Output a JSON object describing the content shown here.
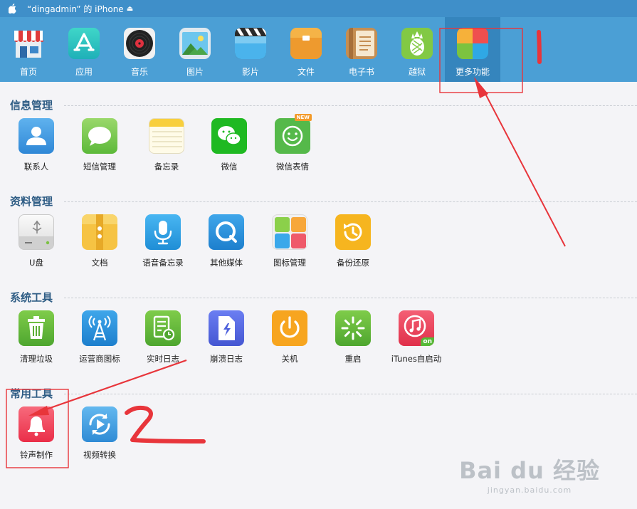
{
  "titlebar": {
    "device_name": "“dingadmin” 的 iPhone"
  },
  "toolbar": {
    "items": [
      {
        "label": "首页"
      },
      {
        "label": "应用"
      },
      {
        "label": "音乐"
      },
      {
        "label": "图片"
      },
      {
        "label": "影片"
      },
      {
        "label": "文件"
      },
      {
        "label": "电子书"
      },
      {
        "label": "越狱"
      },
      {
        "label": "更多功能"
      }
    ]
  },
  "sections": [
    {
      "title": "信息管理",
      "apps": [
        {
          "label": "联系人"
        },
        {
          "label": "短信管理"
        },
        {
          "label": "备忘录"
        },
        {
          "label": "微信"
        },
        {
          "label": "微信表情",
          "badge": "NEW"
        }
      ]
    },
    {
      "title": "资料管理",
      "apps": [
        {
          "label": "U盘"
        },
        {
          "label": "文档"
        },
        {
          "label": "语音备忘录"
        },
        {
          "label": "其他媒体"
        },
        {
          "label": "图标管理"
        },
        {
          "label": "备份还原"
        }
      ]
    },
    {
      "title": "系统工具",
      "apps": [
        {
          "label": "清理垃圾"
        },
        {
          "label": "运营商图标"
        },
        {
          "label": "实时日志"
        },
        {
          "label": "崩溃日志"
        },
        {
          "label": "关机"
        },
        {
          "label": "重启"
        },
        {
          "label": "iTunes自启动",
          "badge": "on"
        }
      ]
    },
    {
      "title": "常用工具",
      "apps": [
        {
          "label": "铃声制作"
        },
        {
          "label": "视频转换"
        }
      ]
    }
  ],
  "annotations": {
    "mark1": "1",
    "mark2": "2"
  },
  "watermark": {
    "logo": "Bai du 经验",
    "url": "jingyan.baidu.com"
  },
  "colors": {
    "toolbar": "#4b9fd5",
    "titlebar": "#3f8fc9",
    "active_tab": "#3585bd",
    "annotation": "#e8353b",
    "section_title": "#2f5d85"
  }
}
